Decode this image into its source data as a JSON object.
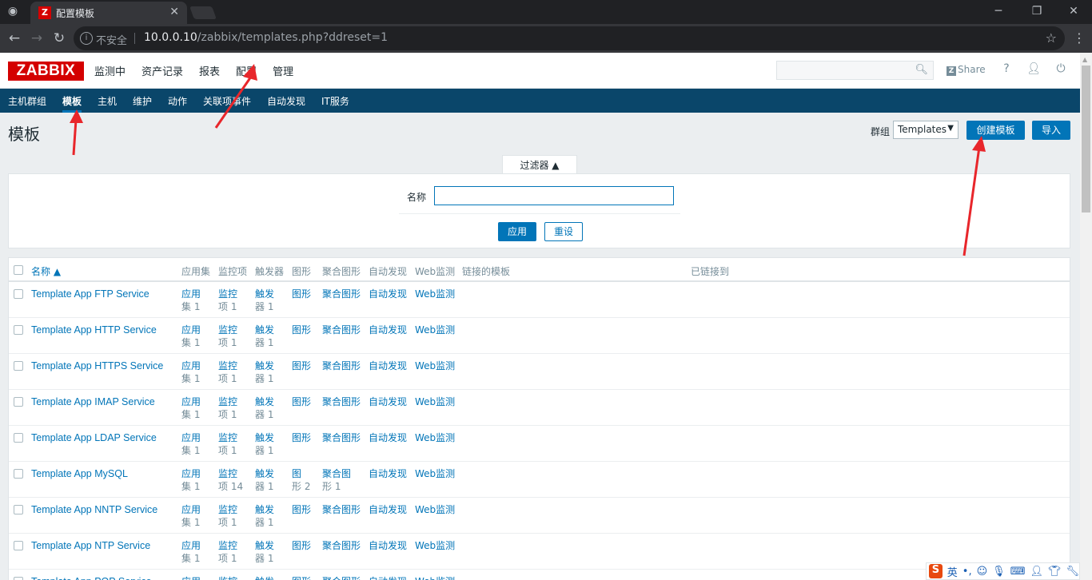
{
  "browser": {
    "tab_title": "配置模板",
    "security": "不安全",
    "url_host": "10.0.0.10",
    "url_path": "/zabbix/templates.php?ddreset=1"
  },
  "header": {
    "logo": "ZABBIX",
    "menu": [
      "监测中",
      "资产记录",
      "报表",
      "配置",
      "管理"
    ],
    "share": "Share",
    "help": "?"
  },
  "submenu": [
    "主机群组",
    "模板",
    "主机",
    "维护",
    "动作",
    "关联项事件",
    "自动发现",
    "IT服务"
  ],
  "page": {
    "title": "模板",
    "group_label": "群组",
    "group_value": "Templates",
    "create_button": "创建模板",
    "import_button": "导入"
  },
  "filter": {
    "tab": "过滤器 ▲",
    "name_label": "名称",
    "name_value": "",
    "apply": "应用",
    "reset": "重设"
  },
  "table": {
    "headers": [
      "名称 ▲",
      "应用集",
      "监控项",
      "触发器",
      "图形",
      "聚合图形",
      "自动发现",
      "Web监测",
      "链接的模板",
      "已链接到"
    ],
    "rows": [
      {
        "name": "Template App FTP Service",
        "apps": [
          "应用",
          "集 1"
        ],
        "items": [
          "监控",
          "项 1"
        ],
        "triggers": [
          "触发",
          "器 1"
        ],
        "graphs": [
          "图形",
          ""
        ],
        "screens": [
          "聚合图形",
          ""
        ],
        "discovery": "自动发现",
        "web": "Web监测"
      },
      {
        "name": "Template App HTTP Service",
        "apps": [
          "应用",
          "集 1"
        ],
        "items": [
          "监控",
          "项 1"
        ],
        "triggers": [
          "触发",
          "器 1"
        ],
        "graphs": [
          "图形",
          ""
        ],
        "screens": [
          "聚合图形",
          ""
        ],
        "discovery": "自动发现",
        "web": "Web监测"
      },
      {
        "name": "Template App HTTPS Service",
        "apps": [
          "应用",
          "集 1"
        ],
        "items": [
          "监控",
          "项 1"
        ],
        "triggers": [
          "触发",
          "器 1"
        ],
        "graphs": [
          "图形",
          ""
        ],
        "screens": [
          "聚合图形",
          ""
        ],
        "discovery": "自动发现",
        "web": "Web监测"
      },
      {
        "name": "Template App IMAP Service",
        "apps": [
          "应用",
          "集 1"
        ],
        "items": [
          "监控",
          "项 1"
        ],
        "triggers": [
          "触发",
          "器 1"
        ],
        "graphs": [
          "图形",
          ""
        ],
        "screens": [
          "聚合图形",
          ""
        ],
        "discovery": "自动发现",
        "web": "Web监测"
      },
      {
        "name": "Template App LDAP Service",
        "apps": [
          "应用",
          "集 1"
        ],
        "items": [
          "监控",
          "项 1"
        ],
        "triggers": [
          "触发",
          "器 1"
        ],
        "graphs": [
          "图形",
          ""
        ],
        "screens": [
          "聚合图形",
          ""
        ],
        "discovery": "自动发现",
        "web": "Web监测"
      },
      {
        "name": "Template App MySQL",
        "apps": [
          "应用",
          "集 1"
        ],
        "items": [
          "监控",
          "项 14"
        ],
        "triggers": [
          "触发",
          "器 1"
        ],
        "graphs": [
          "图",
          "形 2"
        ],
        "screens": [
          "聚合图",
          "形 1"
        ],
        "discovery": "自动发现",
        "web": "Web监测"
      },
      {
        "name": "Template App NNTP Service",
        "apps": [
          "应用",
          "集 1"
        ],
        "items": [
          "监控",
          "项 1"
        ],
        "triggers": [
          "触发",
          "器 1"
        ],
        "graphs": [
          "图形",
          ""
        ],
        "screens": [
          "聚合图形",
          ""
        ],
        "discovery": "自动发现",
        "web": "Web监测"
      },
      {
        "name": "Template App NTP Service",
        "apps": [
          "应用",
          "集 1"
        ],
        "items": [
          "监控",
          "项 1"
        ],
        "triggers": [
          "触发",
          "器 1"
        ],
        "graphs": [
          "图形",
          ""
        ],
        "screens": [
          "聚合图形",
          ""
        ],
        "discovery": "自动发现",
        "web": "Web监测"
      },
      {
        "name": "Template App POP Service",
        "apps": [
          "应用",
          ""
        ],
        "items": [
          "监控",
          ""
        ],
        "triggers": [
          "触发",
          ""
        ],
        "graphs": [
          "图形",
          ""
        ],
        "screens": [
          "聚合图形",
          ""
        ],
        "discovery": "自动发现",
        "web": "Web监测"
      }
    ]
  },
  "ime": {
    "lang": "英"
  },
  "colors": {
    "zabbix_red": "#d40000",
    "nav_blue": "#0a466a",
    "link_blue": "#0275b8",
    "annotation_red": "#e8262b"
  }
}
